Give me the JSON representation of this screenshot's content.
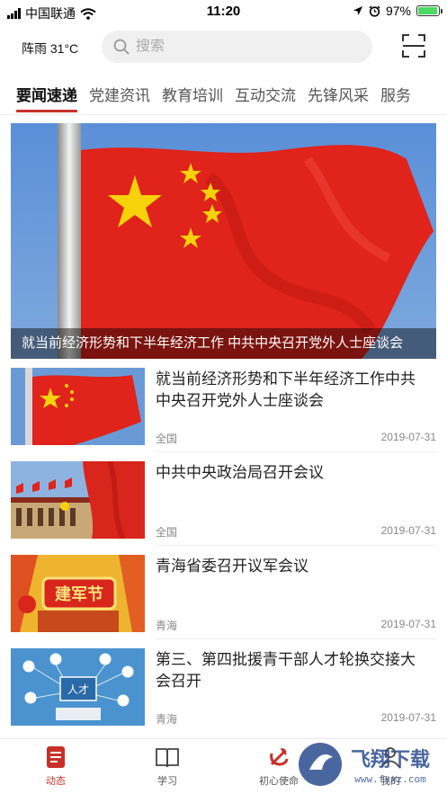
{
  "status_bar": {
    "carrier": "中国联通",
    "time": "11:20",
    "battery": "97%",
    "battery_level": 0.97
  },
  "header": {
    "weather": "阵雨 31°C",
    "search_placeholder": "搜索",
    "scan_icon": "scan-icon"
  },
  "tabs": [
    {
      "label": "要闻速递",
      "active": true
    },
    {
      "label": "党建资讯",
      "active": false
    },
    {
      "label": "教育培训",
      "active": false
    },
    {
      "label": "互动交流",
      "active": false
    },
    {
      "label": "先锋风采",
      "active": false
    },
    {
      "label": "服务",
      "active": false
    }
  ],
  "hero": {
    "caption": "就当前经济形势和下半年经济工作 中共中央召开党外人士座谈会"
  },
  "news": [
    {
      "title": "就当前经济形势和下半年经济工作中共中央召开党外人士座谈会",
      "region": "全国",
      "date": "2019-07-31"
    },
    {
      "title": "中共中央政治局召开会议",
      "region": "全国",
      "date": "2019-07-31"
    },
    {
      "title": "青海省委召开议军会议",
      "region": "青海",
      "date": "2019-07-31"
    },
    {
      "title": "第三、第四批援青干部人才轮换交接大会召开",
      "region": "青海",
      "date": "2019-07-31"
    }
  ],
  "thumb_text": {
    "army_day": "建军节",
    "talent": "人才"
  },
  "bottom_nav": [
    {
      "label": "动态",
      "icon": "news-icon",
      "active": true
    },
    {
      "label": "学习",
      "icon": "book-icon",
      "active": false
    },
    {
      "label": "初心使命",
      "icon": "party-emblem-icon",
      "active": false
    },
    {
      "label": "我的",
      "icon": "user-icon",
      "active": false
    }
  ],
  "watermark": {
    "text": "飞翔下载",
    "url": "www.fxxz.com"
  },
  "colors": {
    "accent": "#c8302a",
    "flag_red": "#e0231b",
    "flag_star": "#f7d20a"
  }
}
